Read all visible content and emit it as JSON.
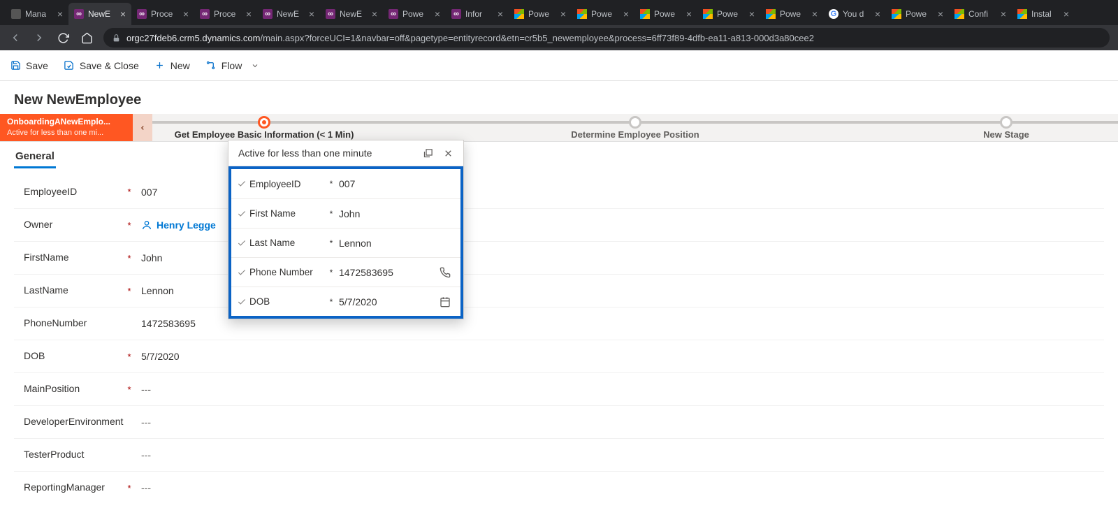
{
  "browser": {
    "url_host": "orgc27fdeb6.crm5.dynamics.com",
    "url_path": "/main.aspx?forceUCI=1&navbar=off&pagetype=entityrecord&etn=cr5b5_newemployee&process=6ff73f89-4dfb-ea11-a813-000d3a80cee2",
    "tabs": [
      {
        "label": "Mana",
        "icon": "other"
      },
      {
        "label": "NewE",
        "icon": "dyn",
        "active": true
      },
      {
        "label": "Proce",
        "icon": "dyn"
      },
      {
        "label": "Proce",
        "icon": "dyn"
      },
      {
        "label": "NewE",
        "icon": "dyn"
      },
      {
        "label": "NewE",
        "icon": "dyn"
      },
      {
        "label": "Powe",
        "icon": "dyn"
      },
      {
        "label": "Infor",
        "icon": "dyn"
      },
      {
        "label": "Powe",
        "icon": "ms"
      },
      {
        "label": "Powe",
        "icon": "ms"
      },
      {
        "label": "Powe",
        "icon": "ms"
      },
      {
        "label": "Powe",
        "icon": "ms"
      },
      {
        "label": "Powe",
        "icon": "ms"
      },
      {
        "label": "You d",
        "icon": "g"
      },
      {
        "label": "Powe",
        "icon": "ms"
      },
      {
        "label": "Confi",
        "icon": "ms"
      },
      {
        "label": "Instal",
        "icon": "ms"
      }
    ]
  },
  "cmdbar": {
    "save": "Save",
    "save_close": "Save & Close",
    "new": "New",
    "flow": "Flow"
  },
  "page": {
    "title": "New NewEmployee"
  },
  "bpf": {
    "name": "OnboardingANewEmplo...",
    "sub": "Active for less than one mi...",
    "stages": [
      {
        "label": "Get Employee Basic Information  (< 1 Min)",
        "state": "active"
      },
      {
        "label": "Determine Employee Position",
        "state": "future"
      },
      {
        "label": "New Stage",
        "state": "future"
      }
    ]
  },
  "tab": {
    "general": "General"
  },
  "form": {
    "fields": [
      {
        "label": "EmployeeID",
        "req": true,
        "value": "007"
      },
      {
        "label": "Owner",
        "req": true,
        "value": "Henry Legge",
        "type": "owner"
      },
      {
        "label": "FirstName",
        "req": true,
        "value": "John"
      },
      {
        "label": "LastName",
        "req": true,
        "value": "Lennon"
      },
      {
        "label": "PhoneNumber",
        "req": false,
        "value": "1472583695"
      },
      {
        "label": "DOB",
        "req": true,
        "value": "5/7/2020"
      },
      {
        "label": "MainPosition",
        "req": true,
        "value": "---",
        "placeholder": true
      },
      {
        "label": "DeveloperEnvironment",
        "req": false,
        "value": "---",
        "placeholder": true
      },
      {
        "label": "TesterProduct",
        "req": false,
        "value": "---",
        "placeholder": true
      },
      {
        "label": "ReportingManager",
        "req": true,
        "value": "---",
        "placeholder": true
      }
    ]
  },
  "flyout": {
    "status": "Active for less than one minute",
    "fields": [
      {
        "label": "EmployeeID",
        "value": "007",
        "icon": ""
      },
      {
        "label": "First Name",
        "value": "John",
        "icon": ""
      },
      {
        "label": "Last Name",
        "value": "Lennon",
        "icon": ""
      },
      {
        "label": "Phone Number",
        "value": "1472583695",
        "icon": "phone"
      },
      {
        "label": "DOB",
        "value": "5/7/2020",
        "icon": "calendar"
      }
    ]
  }
}
